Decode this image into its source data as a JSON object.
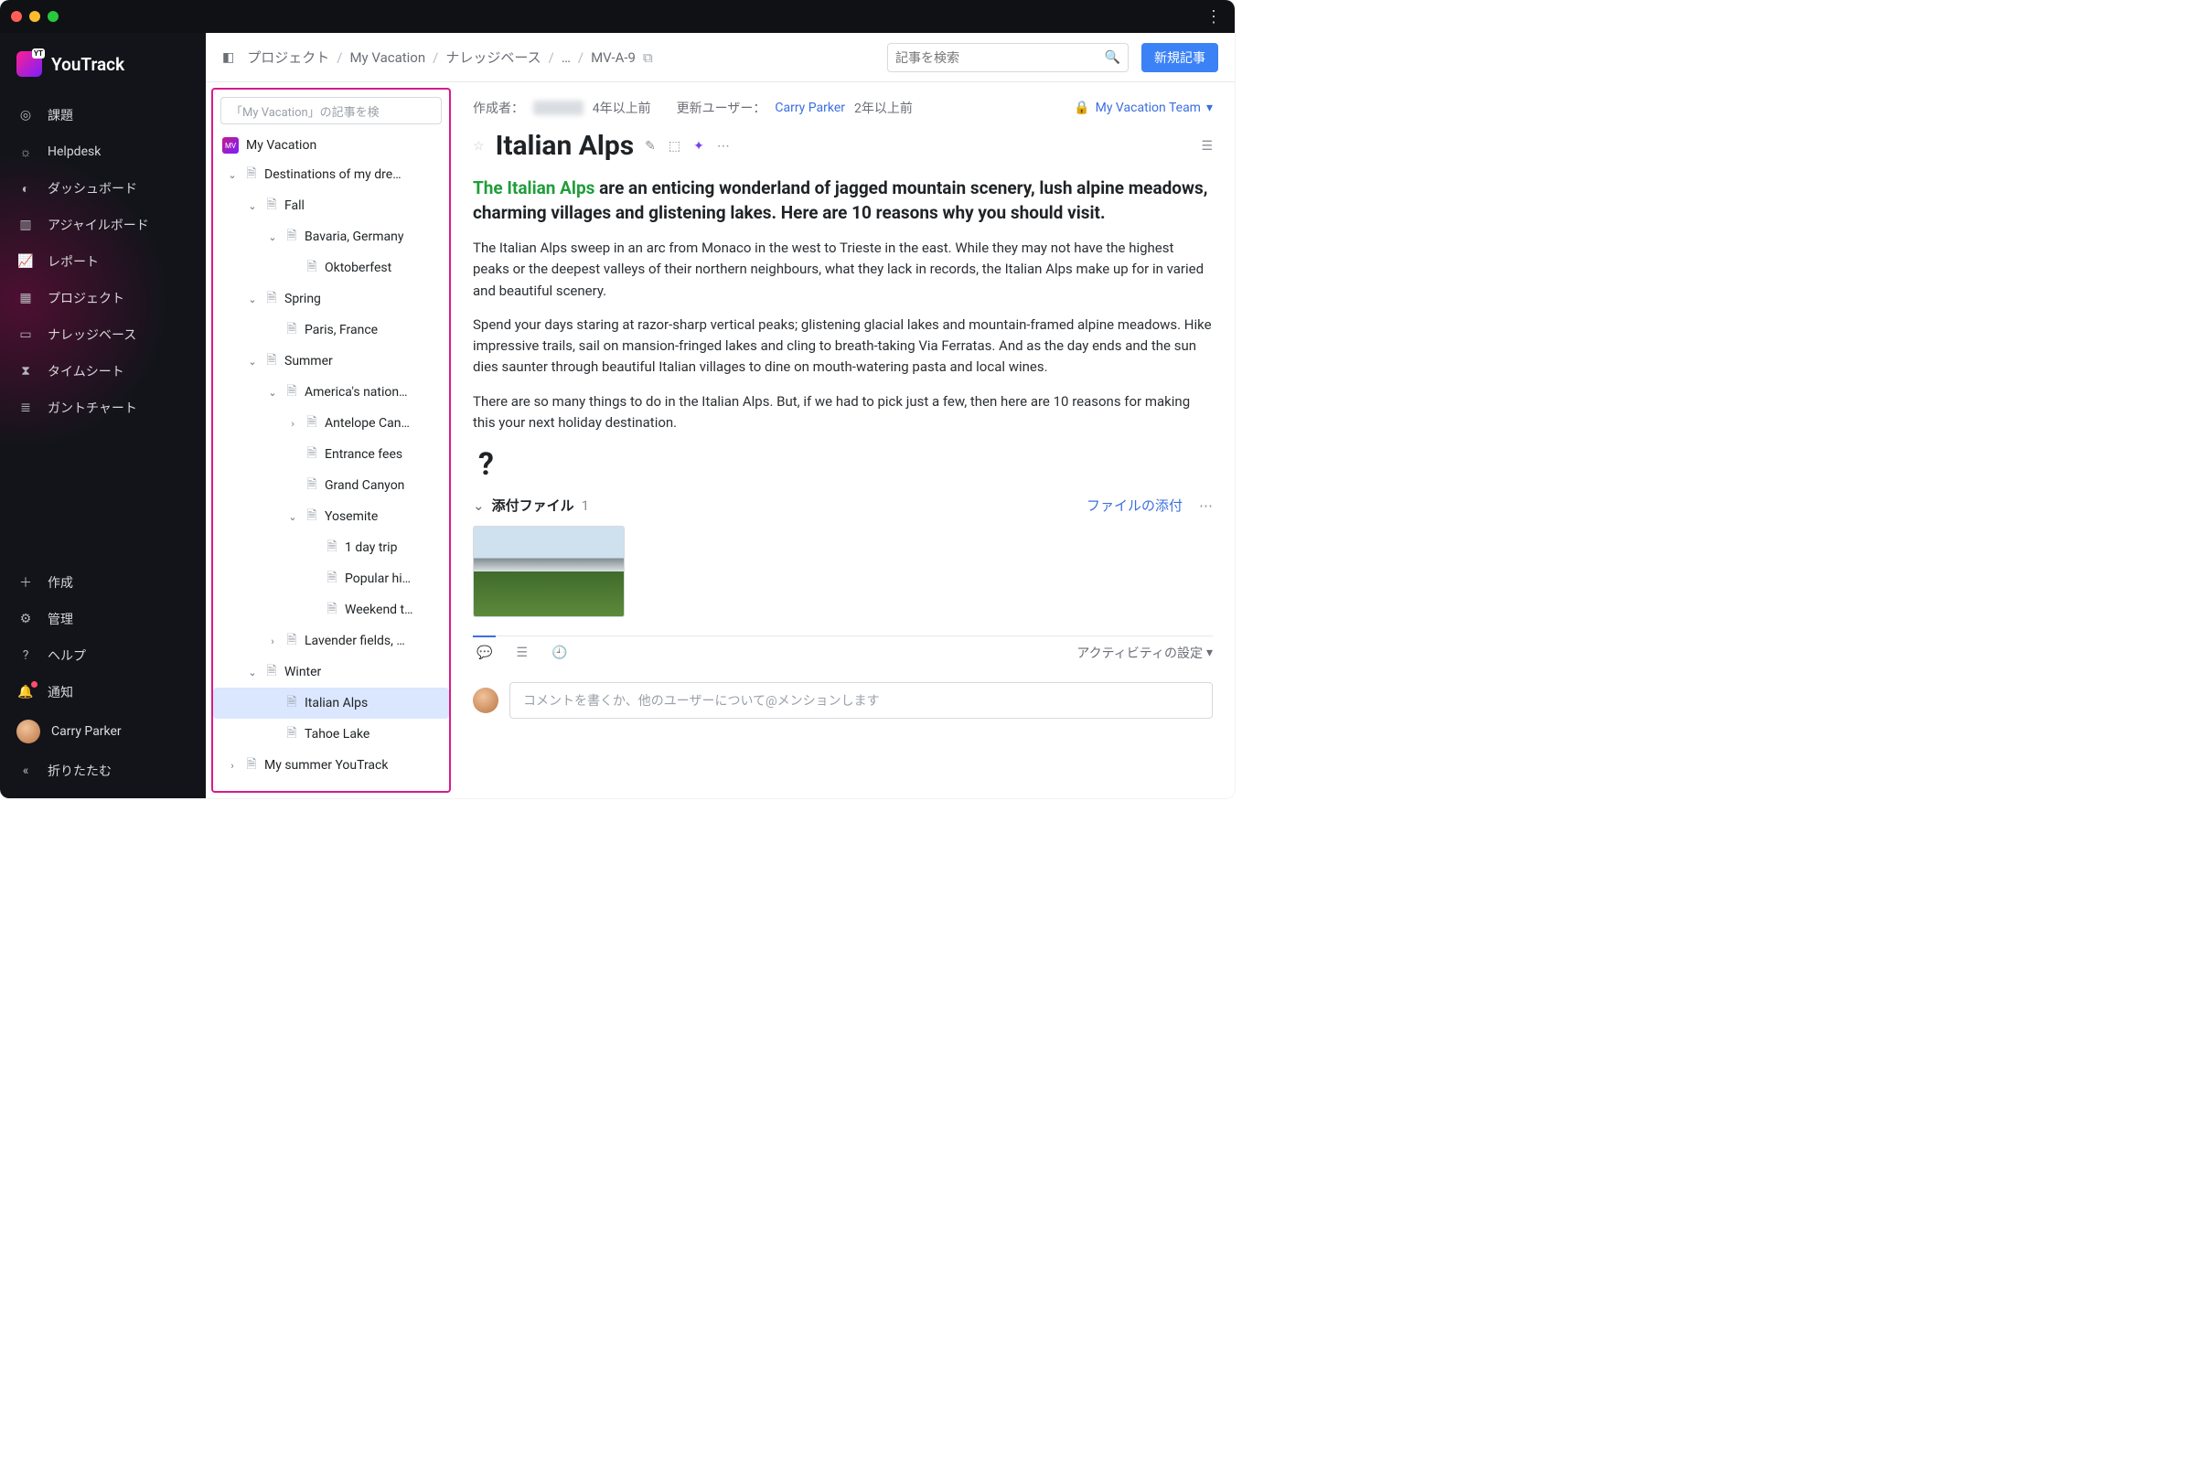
{
  "app": {
    "name": "YouTrack"
  },
  "sidebar": {
    "items": [
      {
        "label": "課題",
        "icon": "check-circle"
      },
      {
        "label": "Helpdesk",
        "icon": "headset"
      },
      {
        "label": "ダッシュボード",
        "icon": "gauge"
      },
      {
        "label": "アジャイルボード",
        "icon": "board"
      },
      {
        "label": "レポート",
        "icon": "chart"
      },
      {
        "label": "プロジェクト",
        "icon": "grid"
      },
      {
        "label": "ナレッジベース",
        "icon": "book"
      },
      {
        "label": "タイムシート",
        "icon": "hourglass"
      },
      {
        "label": "ガントチャート",
        "icon": "gantt"
      }
    ],
    "bottom": {
      "create": "作成",
      "admin": "管理",
      "help": "ヘルプ",
      "notifications": "通知",
      "collapse": "折りたたむ"
    },
    "user": {
      "name": "Carry Parker"
    }
  },
  "breadcrumbs": {
    "items": [
      "プロジェクト",
      "My Vacation",
      "ナレッジベース",
      "…",
      "MV-A-9"
    ]
  },
  "search": {
    "placeholder": "記事を検索"
  },
  "new_button": "新規記事",
  "tree": {
    "search_placeholder": "「My Vacation」の記事を検",
    "project": "My Vacation",
    "items": [
      {
        "depth": 0,
        "expand": "down",
        "label": "Destinations of my dre…"
      },
      {
        "depth": 1,
        "expand": "down",
        "label": "Fall"
      },
      {
        "depth": 2,
        "expand": "down",
        "label": "Bavaria, Germany"
      },
      {
        "depth": 3,
        "expand": "",
        "label": "Oktoberfest"
      },
      {
        "depth": 1,
        "expand": "down",
        "label": "Spring"
      },
      {
        "depth": 2,
        "expand": "",
        "label": "Paris, France"
      },
      {
        "depth": 1,
        "expand": "down",
        "label": "Summer"
      },
      {
        "depth": 2,
        "expand": "down",
        "label": "America's nation…"
      },
      {
        "depth": 3,
        "expand": "right",
        "label": "Antelope Can…"
      },
      {
        "depth": 3,
        "expand": "",
        "label": "Entrance fees"
      },
      {
        "depth": 3,
        "expand": "",
        "label": "Grand Canyon"
      },
      {
        "depth": 3,
        "expand": "down",
        "label": "Yosemite"
      },
      {
        "depth": 4,
        "expand": "",
        "label": "1 day trip"
      },
      {
        "depth": 4,
        "expand": "",
        "label": "Popular hi…"
      },
      {
        "depth": 4,
        "expand": "",
        "label": "Weekend t…"
      },
      {
        "depth": 2,
        "expand": "right",
        "label": "Lavender fields, …"
      },
      {
        "depth": 1,
        "expand": "down",
        "label": "Winter"
      },
      {
        "depth": 2,
        "expand": "",
        "label": "Italian Alps",
        "selected": true,
        "locked": true
      },
      {
        "depth": 2,
        "expand": "",
        "label": "Tahoe Lake"
      },
      {
        "depth": 0,
        "expand": "right",
        "label": "My summer YouTrack"
      }
    ]
  },
  "article": {
    "meta": {
      "created_label": "作成者：",
      "created_ago": "4年以上前",
      "updated_label": "更新ユーザー：",
      "updated_by": "Carry Parker",
      "updated_ago": "2年以上前",
      "visibility": "My Vacation Team"
    },
    "title": "Italian Alps",
    "intro_highlight": "The Italian Alps",
    "intro_rest": " are an enticing wonderland of jagged mountain scenery, lush alpine meadows, charming villages and glistening lakes. Here are 10 reasons why you should visit.",
    "p1": "The Italian Alps sweep in an arc from Monaco in the west to Trieste in the east. While they may not have the highest peaks or the deepest valleys of their northern neighbours, what they lack in records, the Italian Alps make up for in varied and beautiful scenery.",
    "p2": "Spend your days staring at razor-sharp vertical peaks; glistening glacial lakes and mountain-framed alpine meadows. Hike impressive trails, sail on mansion-fringed lakes and cling to breath-taking Via Ferratas. And as the day ends and the sun dies saunter through beautiful Italian villages to dine on mouth-watering pasta and local wines.",
    "p3": "There are so many things to do in the Italian Alps. But, if we had to pick just a few, then here are 10 reasons for making this your next holiday destination.",
    "attachments": {
      "label": "添付ファイル",
      "count": "1",
      "add_link": "ファイルの添付"
    },
    "activity_settings": "アクティビティの設定",
    "comment_placeholder": "コメントを書くか、他のユーザーについて@メンションします"
  }
}
